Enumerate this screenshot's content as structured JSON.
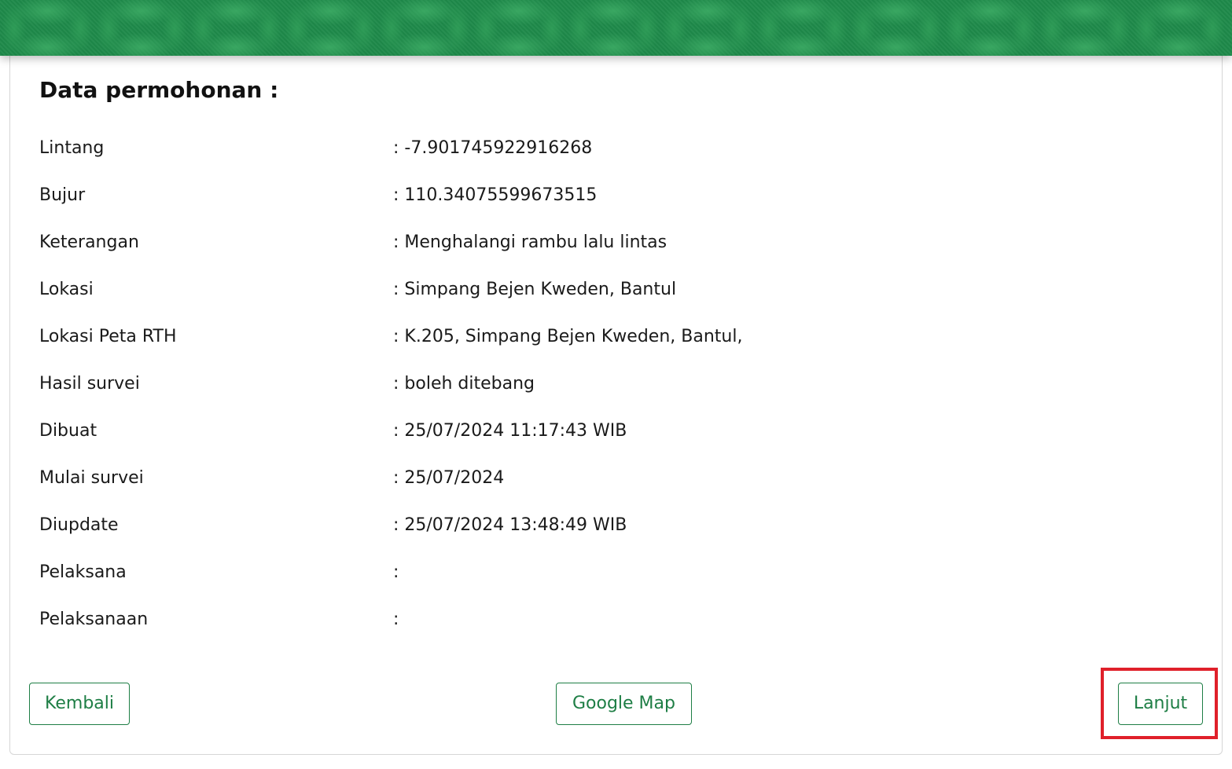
{
  "section": {
    "title": "Data permohonan :"
  },
  "fields": [
    {
      "label": "Lintang",
      "value": ": -7.901745922916268"
    },
    {
      "label": "Bujur",
      "value": ": 110.34075599673515"
    },
    {
      "label": "Keterangan",
      "value": ": Menghalangi rambu lalu lintas"
    },
    {
      "label": "Lokasi",
      "value": ": Simpang Bejen Kweden, Bantul"
    },
    {
      "label": "Lokasi Peta RTH",
      "value": ": K.205, Simpang Bejen Kweden, Bantul,"
    },
    {
      "label": "Hasil survei",
      "value": ": boleh ditebang"
    },
    {
      "label": "Dibuat",
      "value": ": 25/07/2024 11:17:43 WIB"
    },
    {
      "label": "Mulai survei",
      "value": ": 25/07/2024"
    },
    {
      "label": "Diupdate",
      "value": ": 25/07/2024 13:48:49 WIB"
    },
    {
      "label": "Pelaksana",
      "value": ":"
    },
    {
      "label": "Pelaksanaan",
      "value": ":"
    }
  ],
  "buttons": {
    "back_label": "Kembali",
    "map_label": "Google Map",
    "next_label": "Lanjut"
  },
  "colors": {
    "header_green": "#1e8a4a",
    "button_green": "#1e7e45",
    "highlight_red": "#e0202a"
  }
}
